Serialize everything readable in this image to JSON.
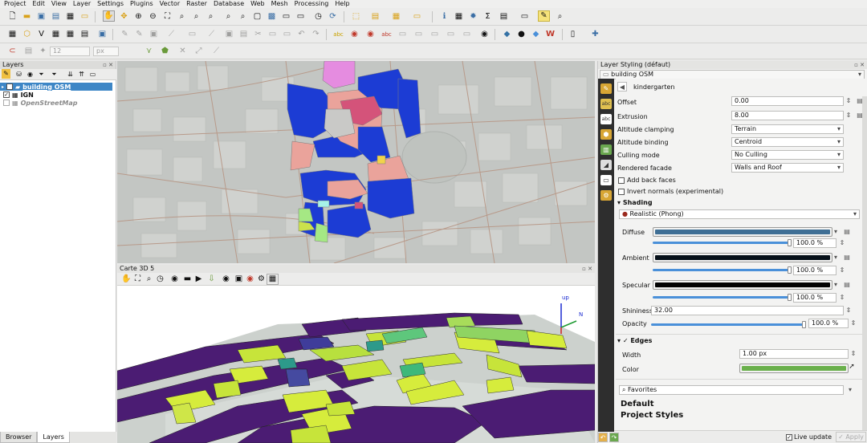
{
  "menu": [
    "Project",
    "Edit",
    "View",
    "Layer",
    "Settings",
    "Plugins",
    "Vector",
    "Raster",
    "Database",
    "Web",
    "Mesh",
    "Processing",
    "Help"
  ],
  "toolbar": {
    "size_value": "12",
    "size_unit": "px"
  },
  "layers_panel": {
    "title": "Layers",
    "items": [
      {
        "name": "building OSM",
        "checked": true,
        "selected": true
      },
      {
        "name": "IGN",
        "checked": true,
        "selected": false
      },
      {
        "name": "OpenStreetMap",
        "checked": false,
        "selected": false
      }
    ],
    "tabs": [
      "Browser",
      "Layers"
    ]
  },
  "map3d": {
    "title": "Carte 3D 5",
    "axis_up": "up",
    "axis_n": "N"
  },
  "styling": {
    "title": "Layer Styling (défaut)",
    "layer_combo": "building OSM",
    "rule_name": "kindergarten",
    "offset_label": "Offset",
    "offset_value": "0.00",
    "extrusion_label": "Extrusion",
    "extrusion_value": "8.00",
    "altitude_clamping_label": "Altitude clamping",
    "altitude_clamping_value": "Terrain",
    "altitude_binding_label": "Altitude binding",
    "altitude_binding_value": "Centroid",
    "culling_label": "Culling mode",
    "culling_value": "No Culling",
    "facade_label": "Rendered facade",
    "facade_value": "Walls and Roof",
    "back_faces_label": "Add back faces",
    "invert_normals_label": "Invert normals (experimental)",
    "shading_header": "Shading",
    "shading_model": "Realistic (Phong)",
    "diffuse_label": "Diffuse",
    "diffuse_pct": "100.0 %",
    "diffuse_color": "#3f6f95",
    "ambient_label": "Ambient",
    "ambient_pct": "100.0 %",
    "ambient_color": "#061019",
    "specular_label": "Specular",
    "specular_pct": "100.0 %",
    "specular_color": "#020202",
    "shininess_label": "Shininess",
    "shininess_value": "32.00",
    "opacity_label": "Opacity",
    "opacity_pct": "100.0 %",
    "edges_header": "Edges",
    "width_label": "Width",
    "width_value": "1.00 px",
    "color_label": "Color",
    "edge_color": "#6ab04c",
    "favorites_placeholder": "Favorites",
    "style_default": "Default",
    "style_project": "Project Styles",
    "live_update_label": "Live update",
    "apply_label": "Apply"
  }
}
